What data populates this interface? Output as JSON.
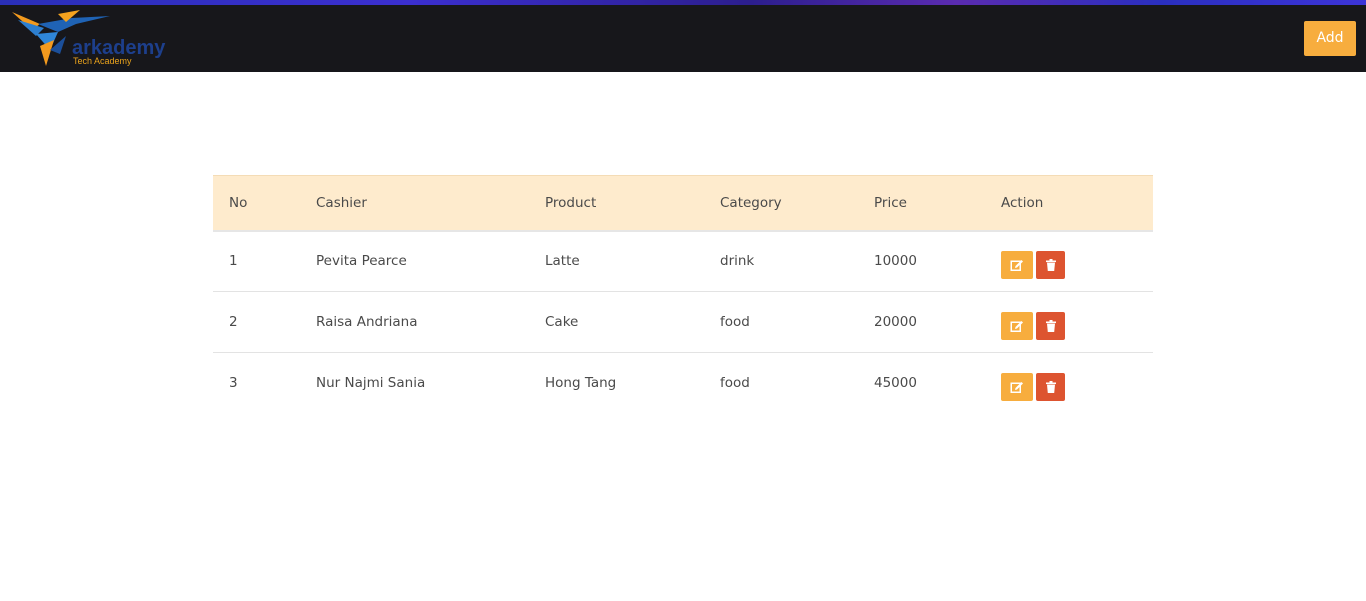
{
  "header": {
    "logo_text": "arkademy",
    "logo_subtitle": "Tech Academy",
    "add_label": "Add"
  },
  "table": {
    "columns": [
      "No",
      "Cashier",
      "Product",
      "Category",
      "Price",
      "Action"
    ],
    "rows": [
      {
        "no": "1",
        "cashier": "Pevita Pearce",
        "product": "Latte",
        "category": "drink",
        "price": "10000"
      },
      {
        "no": "2",
        "cashier": "Raisa Andriana",
        "product": "Cake",
        "category": "food",
        "price": "20000"
      },
      {
        "no": "3",
        "cashier": "Nur Najmi Sania",
        "product": "Hong Tang",
        "category": "food",
        "price": "45000"
      }
    ]
  },
  "icons": {
    "edit": "edit-icon",
    "delete": "trash-icon",
    "logo": "hummingbird-logo-icon"
  },
  "colors": {
    "topbar": "#17171b",
    "accent": "#f7ad3e",
    "danger": "#dd5430",
    "table_header": "#feebcd"
  }
}
